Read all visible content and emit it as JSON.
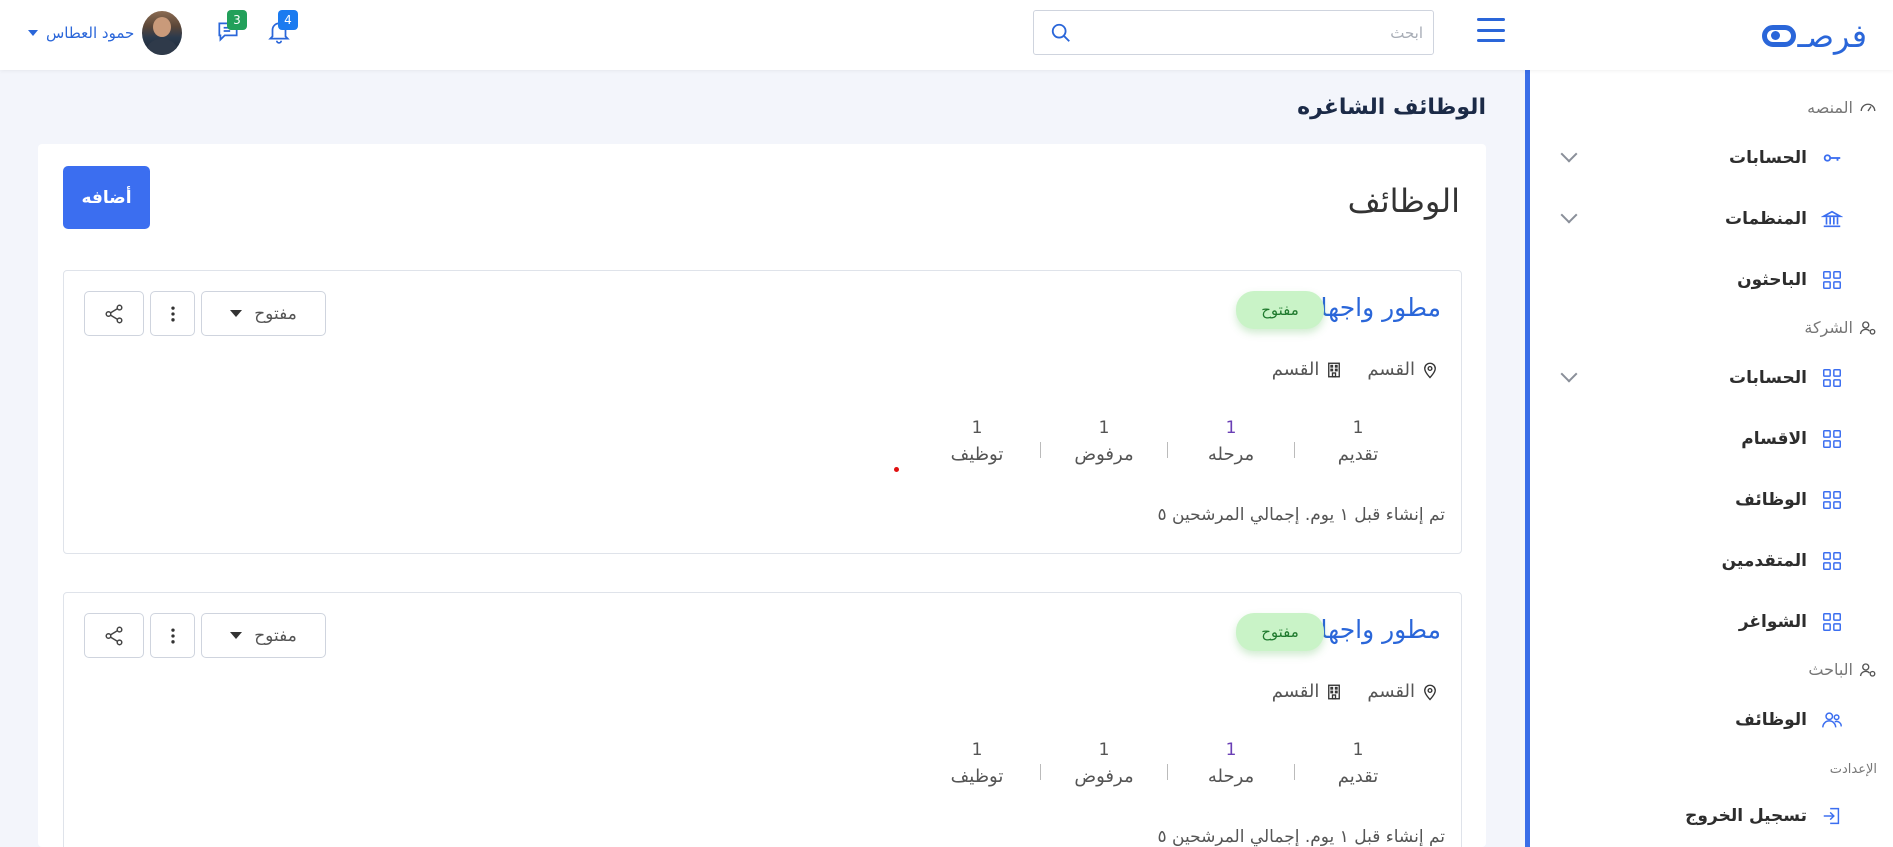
{
  "brand": {
    "logo_text": "فرصـ"
  },
  "header": {
    "search_placeholder": "ابحث",
    "user_name": "حمود العطاس",
    "messages_count": "3",
    "notifications_count": "4"
  },
  "sidebar": {
    "sections": [
      {
        "title": "المنصه",
        "icon": "dashboard-icon"
      },
      {
        "title": "الشركة",
        "icon": "user-cog-icon"
      },
      {
        "title": "الباحث",
        "icon": "user-cog-icon"
      }
    ],
    "items": [
      {
        "label": "الحسابات",
        "icon": "key-icon",
        "has_children": true
      },
      {
        "label": "المنظمات",
        "icon": "bank-icon",
        "has_children": true
      },
      {
        "label": "الباحثون",
        "icon": "grid-icon",
        "has_children": false
      },
      {
        "label": "الحسابات",
        "icon": "grid-icon",
        "has_children": true
      },
      {
        "label": "الاقسام",
        "icon": "grid-icon",
        "has_children": false
      },
      {
        "label": "الوظائف",
        "icon": "grid-icon",
        "has_children": false
      },
      {
        "label": "المتقدمين",
        "icon": "grid-icon",
        "has_children": false
      },
      {
        "label": "الشواغر",
        "icon": "grid-icon",
        "has_children": false
      },
      {
        "label": "الوظائف",
        "icon": "users-icon",
        "has_children": false
      }
    ],
    "settings_title": "الإعدادت",
    "logout_label": "تسجيل الخروج"
  },
  "main": {
    "page_title": "الوظائف الشاغره",
    "panel_title": "الوظائف",
    "add_button_label": "أضافه",
    "jobs": [
      {
        "title": "مطور واجهات",
        "status": "مفتوح",
        "location": "القسم",
        "department": "القسم",
        "stats": [
          {
            "value": "1",
            "label": "تقديم"
          },
          {
            "value": "1",
            "label": "مرحله"
          },
          {
            "value": "1",
            "label": "مرفوض"
          },
          {
            "value": "1",
            "label": "توظيف"
          }
        ],
        "created_text": "تم إنشاء قبل ١ يوم. إجمالي المرشحين ٥",
        "status_dropdown": "مفتوح"
      },
      {
        "title": "مطور واجهات",
        "status": "مفتوح",
        "location": "القسم",
        "department": "القسم",
        "stats": [
          {
            "value": "1",
            "label": "تقديم"
          },
          {
            "value": "1",
            "label": "مرحله"
          },
          {
            "value": "1",
            "label": "مرفوض"
          },
          {
            "value": "1",
            "label": "توظيف"
          }
        ],
        "created_text": "تم إنشاء قبل ١ يوم. إجمالي المرشحين ٥",
        "status_dropdown": "مفتوح"
      }
    ]
  },
  "colors": {
    "accent": "#3b6ef0",
    "brand": "#2a66d9",
    "status_bg": "#c9f3c7"
  }
}
